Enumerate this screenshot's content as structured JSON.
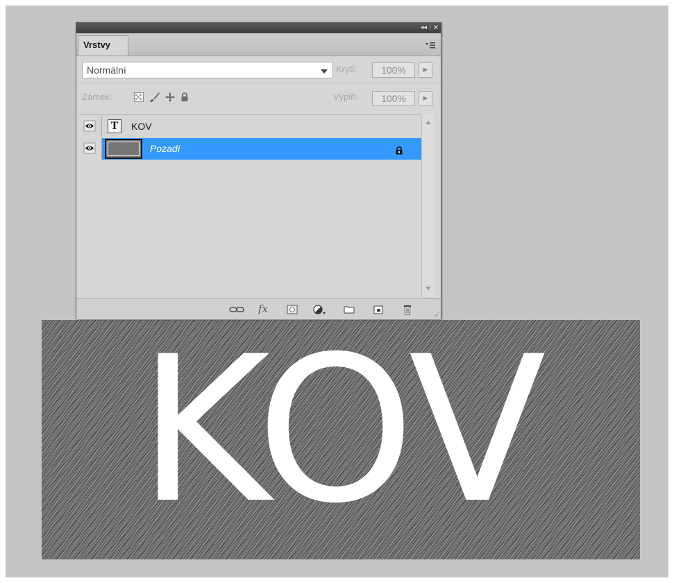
{
  "panel": {
    "title_controls": {
      "collapse": "◂◂",
      "separator": "|",
      "close": "✕"
    },
    "tab_label": "Vrstvy",
    "menu_icon": "panel-menu-icon",
    "blend_mode": {
      "value": "Normální"
    },
    "opacity": {
      "label": "Krytí:",
      "value": "100%"
    },
    "lock": {
      "label": "Zámek:",
      "icons": [
        "lock-transparency-icon",
        "lock-paint-icon",
        "lock-position-icon",
        "lock-all-icon"
      ]
    },
    "fill": {
      "label": "Výplň:",
      "value": "100%"
    },
    "layers": [
      {
        "name": "KOV",
        "type": "text",
        "visible": true,
        "selected": false
      },
      {
        "name": "Pozadí",
        "type": "background",
        "visible": true,
        "selected": true,
        "locked": true
      }
    ],
    "bottom_icons": [
      "link-layers-icon",
      "fx-icon",
      "add-mask-icon",
      "adjustment-layer-icon",
      "new-group-icon",
      "new-layer-icon",
      "delete-layer-icon"
    ],
    "fx_label": "fx",
    "selection_color": "#3399ff"
  },
  "document": {
    "text": "KOV"
  }
}
